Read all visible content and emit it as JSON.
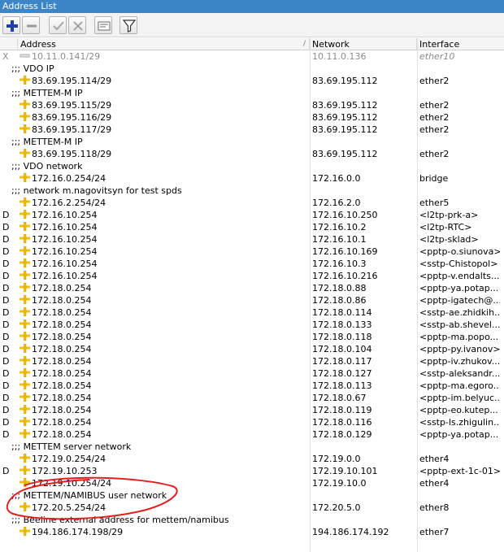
{
  "window": {
    "title": "Address List"
  },
  "toolbar": {
    "buttons": [
      {
        "name": "add-button",
        "icon": "plus-icon"
      },
      {
        "name": "remove-button",
        "icon": "minus-icon"
      },
      {
        "name": "enable-button",
        "icon": "check-icon"
      },
      {
        "name": "disable-button",
        "icon": "cross-icon"
      },
      {
        "name": "comment-button",
        "icon": "comment-icon"
      },
      {
        "name": "filter-button",
        "icon": "funnel-icon"
      }
    ]
  },
  "columns": {
    "flag": "",
    "address": "Address",
    "sort_indicator": "/",
    "network": "Network",
    "interface": "Interface"
  },
  "rows": [
    {
      "kind": "entry",
      "flag": "X",
      "address": "10.11.0.141/29",
      "network": "10.11.0.136",
      "interface": "ether10",
      "disabled": true
    },
    {
      "kind": "comment",
      "text": ";;; VDO IP"
    },
    {
      "kind": "entry",
      "flag": "",
      "address": "83.69.195.114/29",
      "network": "83.69.195.112",
      "interface": "ether2"
    },
    {
      "kind": "comment",
      "text": ";;; METTEM-M IP"
    },
    {
      "kind": "entry",
      "flag": "",
      "address": "83.69.195.115/29",
      "network": "83.69.195.112",
      "interface": "ether2"
    },
    {
      "kind": "entry",
      "flag": "",
      "address": "83.69.195.116/29",
      "network": "83.69.195.112",
      "interface": "ether2"
    },
    {
      "kind": "entry",
      "flag": "",
      "address": "83.69.195.117/29",
      "network": "83.69.195.112",
      "interface": "ether2"
    },
    {
      "kind": "comment",
      "text": ";;; METTEM-M IP"
    },
    {
      "kind": "entry",
      "flag": "",
      "address": "83.69.195.118/29",
      "network": "83.69.195.112",
      "interface": "ether2"
    },
    {
      "kind": "comment",
      "text": ";;; VDO network"
    },
    {
      "kind": "entry",
      "flag": "",
      "address": "172.16.0.254/24",
      "network": "172.16.0.0",
      "interface": "bridge"
    },
    {
      "kind": "comment",
      "text": ";;; network m.nagovitsyn for test spds"
    },
    {
      "kind": "entry",
      "flag": "",
      "address": "172.16.2.254/24",
      "network": "172.16.2.0",
      "interface": "ether5"
    },
    {
      "kind": "entry",
      "flag": "D",
      "address": "172.16.10.254",
      "network": "172.16.10.250",
      "interface": "<l2tp-prk-a>"
    },
    {
      "kind": "entry",
      "flag": "D",
      "address": "172.16.10.254",
      "network": "172.16.10.2",
      "interface": "<l2tp-RTC>"
    },
    {
      "kind": "entry",
      "flag": "D",
      "address": "172.16.10.254",
      "network": "172.16.10.1",
      "interface": "<l2tp-sklad>"
    },
    {
      "kind": "entry",
      "flag": "D",
      "address": "172.16.10.254",
      "network": "172.16.10.169",
      "interface": "<pptp-o.siunova>"
    },
    {
      "kind": "entry",
      "flag": "D",
      "address": "172.16.10.254",
      "network": "172.16.10.3",
      "interface": "<sstp-Chistopol>"
    },
    {
      "kind": "entry",
      "flag": "D",
      "address": "172.16.10.254",
      "network": "172.16.10.216",
      "interface": "<pptp-v.endalts..."
    },
    {
      "kind": "entry",
      "flag": "D",
      "address": "172.18.0.254",
      "network": "172.18.0.88",
      "interface": "<pptp-ya.potap..."
    },
    {
      "kind": "entry",
      "flag": "D",
      "address": "172.18.0.254",
      "network": "172.18.0.86",
      "interface": "<pptp-igatech@..."
    },
    {
      "kind": "entry",
      "flag": "D",
      "address": "172.18.0.254",
      "network": "172.18.0.114",
      "interface": "<sstp-ae.zhidkih..."
    },
    {
      "kind": "entry",
      "flag": "D",
      "address": "172.18.0.254",
      "network": "172.18.0.133",
      "interface": "<sstp-ab.shevel..."
    },
    {
      "kind": "entry",
      "flag": "D",
      "address": "172.18.0.254",
      "network": "172.18.0.118",
      "interface": "<pptp-ma.popo..."
    },
    {
      "kind": "entry",
      "flag": "D",
      "address": "172.18.0.254",
      "network": "172.18.0.104",
      "interface": "<pptp-py.ivanov>"
    },
    {
      "kind": "entry",
      "flag": "D",
      "address": "172.18.0.254",
      "network": "172.18.0.117",
      "interface": "<pptp-iv.zhukov..."
    },
    {
      "kind": "entry",
      "flag": "D",
      "address": "172.18.0.254",
      "network": "172.18.0.127",
      "interface": "<sstp-aleksandr..."
    },
    {
      "kind": "entry",
      "flag": "D",
      "address": "172.18.0.254",
      "network": "172.18.0.113",
      "interface": "<pptp-ma.egoro..."
    },
    {
      "kind": "entry",
      "flag": "D",
      "address": "172.18.0.254",
      "network": "172.18.0.67",
      "interface": "<pptp-im.belyuc..."
    },
    {
      "kind": "entry",
      "flag": "D",
      "address": "172.18.0.254",
      "network": "172.18.0.119",
      "interface": "<pptp-eo.kutep..."
    },
    {
      "kind": "entry",
      "flag": "D",
      "address": "172.18.0.254",
      "network": "172.18.0.116",
      "interface": "<sstp-ls.zhigulin..."
    },
    {
      "kind": "entry",
      "flag": "D",
      "address": "172.18.0.254",
      "network": "172.18.0.129",
      "interface": "<pptp-ya.potap..."
    },
    {
      "kind": "comment",
      "text": ";;; METTEM server network"
    },
    {
      "kind": "entry",
      "flag": "",
      "address": "172.19.0.254/24",
      "network": "172.19.0.0",
      "interface": "ether4"
    },
    {
      "kind": "entry",
      "flag": "D",
      "address": "172.19.10.253",
      "network": "172.19.10.101",
      "interface": "<pptp-ext-1c-01>"
    },
    {
      "kind": "entry",
      "flag": "",
      "address": "172.19.10.254/24",
      "network": "172.19.10.0",
      "interface": "ether4"
    },
    {
      "kind": "comment",
      "text": ";;; METTEM/NAMIBUS user network"
    },
    {
      "kind": "entry",
      "flag": "",
      "address": "172.20.5.254/24",
      "network": "172.20.5.0",
      "interface": "ether8"
    },
    {
      "kind": "comment",
      "text": ";;; Beeline external address for mettem/namibus"
    },
    {
      "kind": "entry",
      "flag": "",
      "address": "194.186.174.198/29",
      "network": "194.186.174.192",
      "interface": "ether7"
    }
  ],
  "colors": {
    "title_bar": "#3c86c8",
    "annotation": "#e02020",
    "pin_yellow": "#f2c200",
    "add_blue": "#1f3fa8"
  }
}
